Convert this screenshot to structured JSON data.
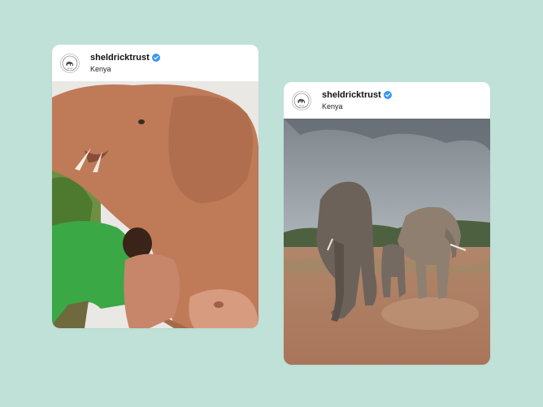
{
  "posts": [
    {
      "username": "sheldricktrust",
      "location": "Kenya",
      "verified": true,
      "image": "elephant-keeper-with-baby-elephants-photo"
    },
    {
      "username": "sheldricktrust",
      "location": "Kenya",
      "verified": true,
      "image": "elephant-herd-on-dusty-plain-photo"
    }
  ],
  "colors": {
    "background": "#bfe1d8",
    "verified_badge": "#3897f0",
    "card": "#ffffff"
  }
}
